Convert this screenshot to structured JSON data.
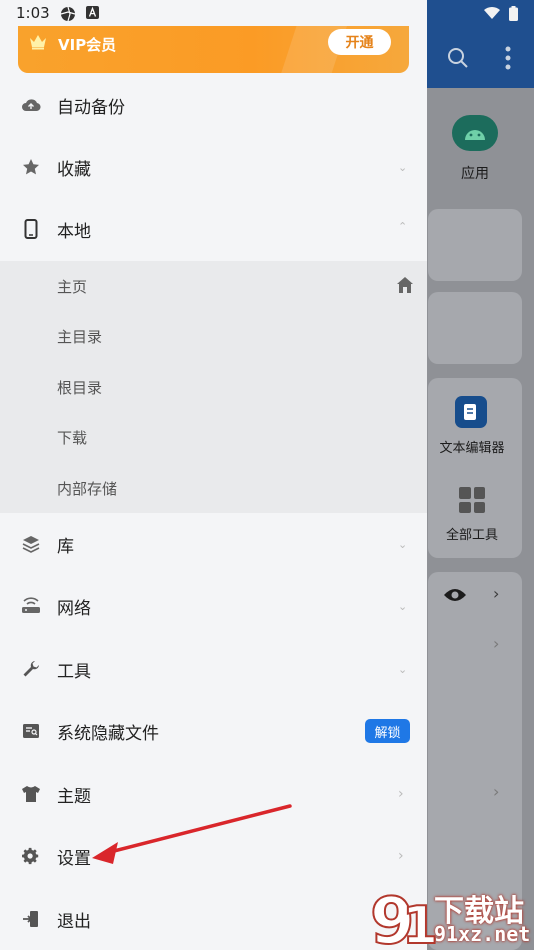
{
  "status_bar": {
    "time": "1:03",
    "left_icons": [
      "aperture-icon",
      "a-badge-icon"
    ],
    "right_icons": [
      "wifi-icon",
      "battery-icon"
    ]
  },
  "background_app": {
    "top_icons": [
      "search-icon",
      "more-vert-icon"
    ],
    "apps_label": "应用",
    "text_editor_label": "文本编辑器",
    "all_tools_label": "全部工具"
  },
  "drawer": {
    "vip": {
      "label": "VIP会员",
      "button": "开通",
      "icon": "crown-icon"
    },
    "items": [
      {
        "label": "自动备份",
        "icon": "cloud-backup-icon"
      },
      {
        "label": "收藏",
        "icon": "star-icon",
        "chevron": "down"
      },
      {
        "label": "本地",
        "icon": "phone-icon",
        "chevron": "up"
      },
      {
        "label": "库",
        "icon": "layers-icon",
        "chevron": "down"
      },
      {
        "label": "网络",
        "icon": "router-icon",
        "chevron": "down"
      },
      {
        "label": "工具",
        "icon": "wrench-icon",
        "chevron": "down"
      },
      {
        "label": "系统隐藏文件",
        "icon": "hidden-file-icon",
        "badge": "解锁"
      },
      {
        "label": "主题",
        "icon": "shirt-icon",
        "chevron": "right"
      },
      {
        "label": "设置",
        "icon": "gear-icon",
        "chevron": "right"
      },
      {
        "label": "退出",
        "icon": "exit-icon"
      }
    ],
    "local_sub_items": [
      {
        "label": "主页",
        "icon": "home-icon"
      },
      {
        "label": "主目录"
      },
      {
        "label": "根目录"
      },
      {
        "label": "下载"
      },
      {
        "label": "内部存储"
      }
    ]
  },
  "watermark": {
    "line1": "下载站",
    "line2": "91xz.net"
  },
  "colors": {
    "vip_orange": "#f9a22c",
    "badge_blue": "#1f78e6",
    "arrow_red": "#d9262b",
    "topbar_blue": "#1f4f8f"
  }
}
